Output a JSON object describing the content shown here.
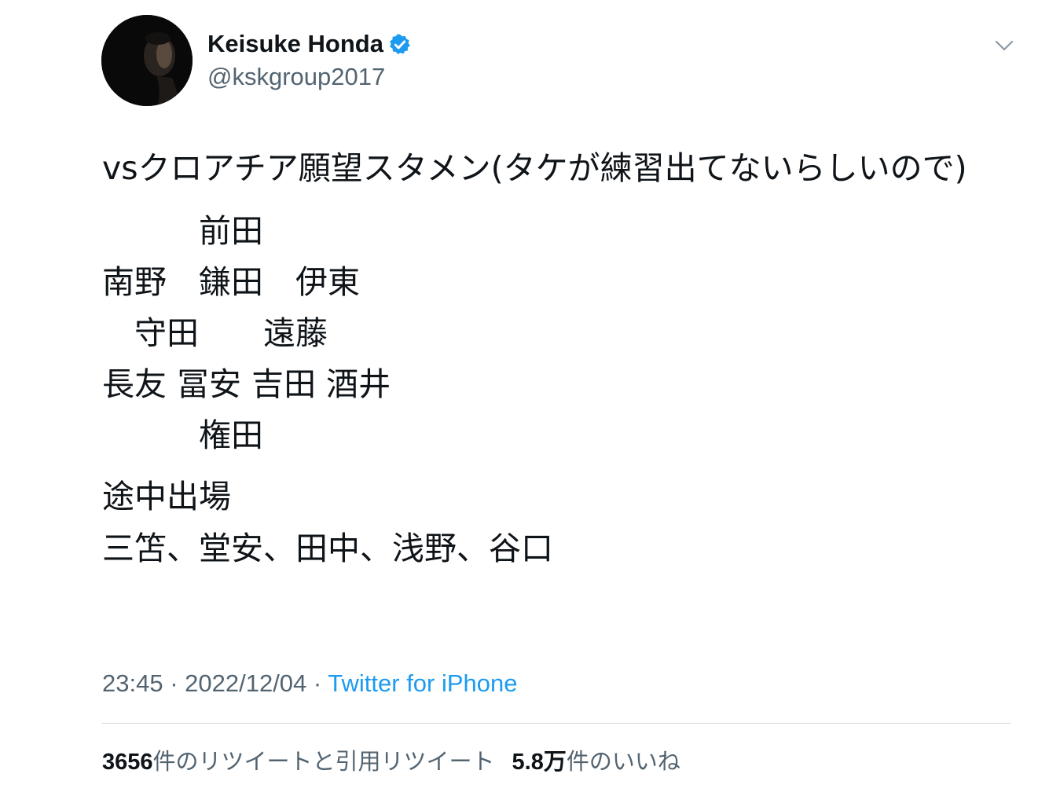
{
  "author": {
    "name": "Keisuke Honda",
    "handle": "@kskgroup2017",
    "verified": true
  },
  "tweet": {
    "intro": "vsクロアチア願望スタメン(タケが練習出てないらしいので)",
    "formation": "　　　前田\n南野　鎌田　伊東\n　守田　　遠藤\n長友 冨安 吉田 酒井\n　　　権田",
    "subs_title": "途中出場",
    "subs_list": "三笘、堂安、田中、浅野、谷口"
  },
  "meta": {
    "time": "23:45",
    "separator": " · ",
    "date": "2022/12/04",
    "source": "Twitter for iPhone"
  },
  "stats": {
    "retweets_count": "3656",
    "retweets_label": "件のリツイートと引用リツイート",
    "likes_count": "5.8万",
    "likes_label": "件のいいね"
  },
  "icons": {
    "verified": "verified-badge-icon",
    "more": "chevron-down-icon"
  },
  "colors": {
    "verified": "#1d9bf0",
    "link": "#1d9bf0",
    "secondary_text": "#536471",
    "divider": "#cfd9de"
  }
}
